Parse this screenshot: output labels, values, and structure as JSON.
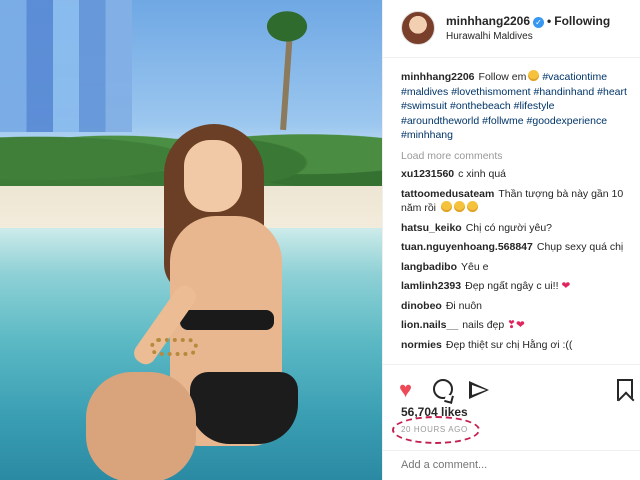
{
  "post": {
    "username": "minhhang2206",
    "following_label": "Following",
    "location": "Hurawalhi Maldives",
    "caption_text": "Follow em",
    "hashtags": [
      "#vacationtime",
      "#maldives",
      "#lovethismoment",
      "#handinhand",
      "#heart",
      "#swimsuit",
      "#onthebeach",
      "#lifestyle",
      "#aroundtheworld",
      "#follwme",
      "#goodexperience",
      "#minhhang"
    ],
    "load_more": "Load more comments"
  },
  "comments": [
    {
      "user": "xu1231560",
      "text": "c xinh quá"
    },
    {
      "user": "tattoomedusateam",
      "text": "Thần tượng bà này gần 10 năm rồi"
    },
    {
      "user": "hatsu_keiko",
      "text": "Chị có người yêu?"
    },
    {
      "user": "tuan.nguyenhoang.568847",
      "text": "Chụp sexy quá chị"
    },
    {
      "user": "langbadibo",
      "text": "Yêu e"
    },
    {
      "user": "lamlinh2393",
      "text": "Đẹp ngất ngây c ui!!"
    },
    {
      "user": "dinobeo",
      "text": "Đi nuôn"
    },
    {
      "user": "lion.nails__",
      "text": "nails đẹp"
    },
    {
      "user": "normies",
      "text": "Đẹp thiệt sư chị Hằng ơi :(("
    }
  ],
  "stats": {
    "likes": "56,704 likes",
    "time": "20 HOURS AGO"
  },
  "composer": {
    "placeholder": "Add a comment..."
  },
  "colors": {
    "accent_like": "#ed4956",
    "verified_blue": "#3897f0",
    "hashtag": "#003569",
    "annotation_circle": "#c4204f"
  },
  "icons": [
    "verified-icon",
    "heart-icon",
    "comment-icon",
    "share-icon",
    "bookmark-icon"
  ]
}
